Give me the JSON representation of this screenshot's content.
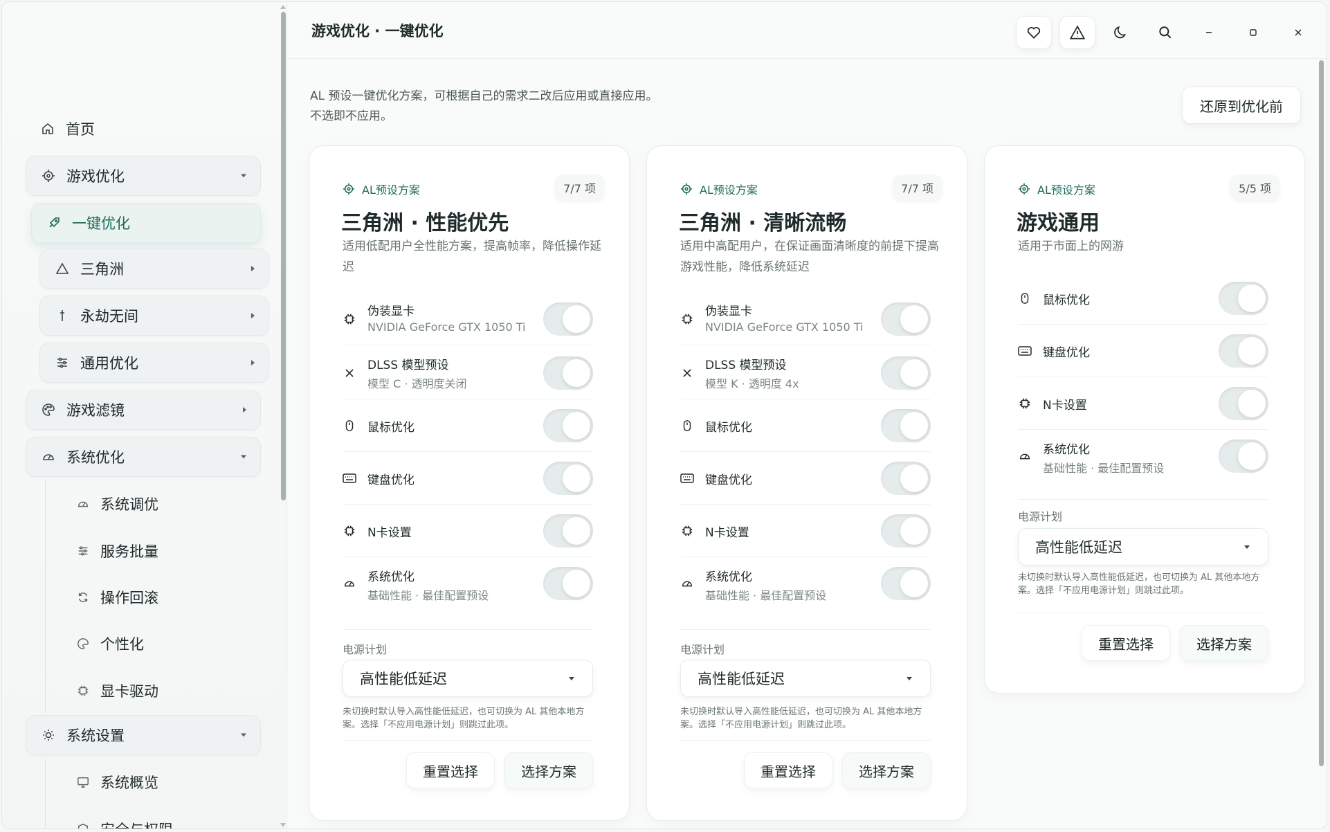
{
  "sidebar": {
    "home": "首页",
    "game_opt": "游戏优化",
    "one_click": "一键优化",
    "delta": "三角洲",
    "naraka": "永劫无间",
    "general_opt": "通用优化",
    "filter": "游戏滤镜",
    "sys_opt": "系统优化",
    "sys_tune": "系统调优",
    "svc_batch": "服务批量",
    "rollback": "操作回滚",
    "personal": "个性化",
    "gpu_driver": "显卡驱动",
    "sys_settings": "系统设置",
    "sys_overview": "系统概览",
    "security": "安全与权限"
  },
  "header": {
    "title": "游戏优化 · 一键优化",
    "icons": [
      "heart-icon",
      "warning-icon",
      "moon-icon",
      "search-icon",
      "minimize-icon",
      "maximize-icon",
      "close-icon"
    ]
  },
  "intro": {
    "line1": "AL 预设一键优化方案，可根据自己的需求二改后应用或直接应用。",
    "line2": "不选即不应用。",
    "restore": "还原到优化前"
  },
  "cards": [
    {
      "tag": "AL预设方案",
      "count": "7/7 项",
      "title": "三角洲 · 性能优先",
      "desc": "适用低配用户全性能方案，提高帧率，降低操作延迟",
      "options": [
        {
          "label": "伪装显卡",
          "sub": "NVIDIA GeForce GTX 1050 Ti",
          "icon": "chip-icon",
          "on": true
        },
        {
          "label": "DLSS 模型预设",
          "sub": "模型 C · 透明度关闭",
          "icon": "x-icon",
          "on": true
        },
        {
          "label": "鼠标优化",
          "sub": "",
          "icon": "mouse-icon",
          "on": true
        },
        {
          "label": "键盘优化",
          "sub": "",
          "icon": "keyboard-icon",
          "on": true
        },
        {
          "label": "N卡设置",
          "sub": "",
          "icon": "chip-icon",
          "on": true
        },
        {
          "label": "系统优化",
          "sub": "基础性能 · 最佳配置预设",
          "icon": "gauge-icon",
          "on": true
        }
      ],
      "power_label": "电源计划",
      "power_value": "高性能低延迟",
      "note": "未切换时默认导入高性能低延迟，也可切换为 AL 其他本地方案。选择「不应用电源计划」则跳过此项。",
      "reset": "重置选择",
      "choose": "选择方案"
    },
    {
      "tag": "AL预设方案",
      "count": "7/7 项",
      "title": "三角洲 · 清晰流畅",
      "desc": "适用中高配用户，在保证画面清晰度的前提下提高游戏性能，降低系统延迟",
      "options": [
        {
          "label": "伪装显卡",
          "sub": "NVIDIA GeForce GTX 1050 Ti",
          "icon": "chip-icon",
          "on": true
        },
        {
          "label": "DLSS 模型预设",
          "sub": "模型 K · 透明度 4x",
          "icon": "x-icon",
          "on": true
        },
        {
          "label": "鼠标优化",
          "sub": "",
          "icon": "mouse-icon",
          "on": true
        },
        {
          "label": "键盘优化",
          "sub": "",
          "icon": "keyboard-icon",
          "on": true
        },
        {
          "label": "N卡设置",
          "sub": "",
          "icon": "chip-icon",
          "on": true
        },
        {
          "label": "系统优化",
          "sub": "基础性能 · 最佳配置预设",
          "icon": "gauge-icon",
          "on": true
        }
      ],
      "power_label": "电源计划",
      "power_value": "高性能低延迟",
      "note": "未切换时默认导入高性能低延迟，也可切换为 AL 其他本地方案。选择「不应用电源计划」则跳过此项。",
      "reset": "重置选择",
      "choose": "选择方案"
    },
    {
      "tag": "AL预设方案",
      "count": "5/5 项",
      "title": "游戏通用",
      "desc": "适用于市面上的网游",
      "options": [
        {
          "label": "鼠标优化",
          "sub": "",
          "icon": "mouse-icon",
          "on": true
        },
        {
          "label": "键盘优化",
          "sub": "",
          "icon": "keyboard-icon",
          "on": true
        },
        {
          "label": "N卡设置",
          "sub": "",
          "icon": "chip-icon",
          "on": true
        },
        {
          "label": "系统优化",
          "sub": "基础性能 · 最佳配置预设",
          "icon": "gauge-icon",
          "on": true
        }
      ],
      "power_label": "电源计划",
      "power_value": "高性能低延迟",
      "note": "未切换时默认导入高性能低延迟，也可切换为 AL 其他本地方案。选择「不应用电源计划」则跳过此项。",
      "reset": "重置选择",
      "choose": "选择方案"
    }
  ],
  "colors": {
    "accent": "#1e6b5c",
    "bg": "#f9fbfb"
  }
}
